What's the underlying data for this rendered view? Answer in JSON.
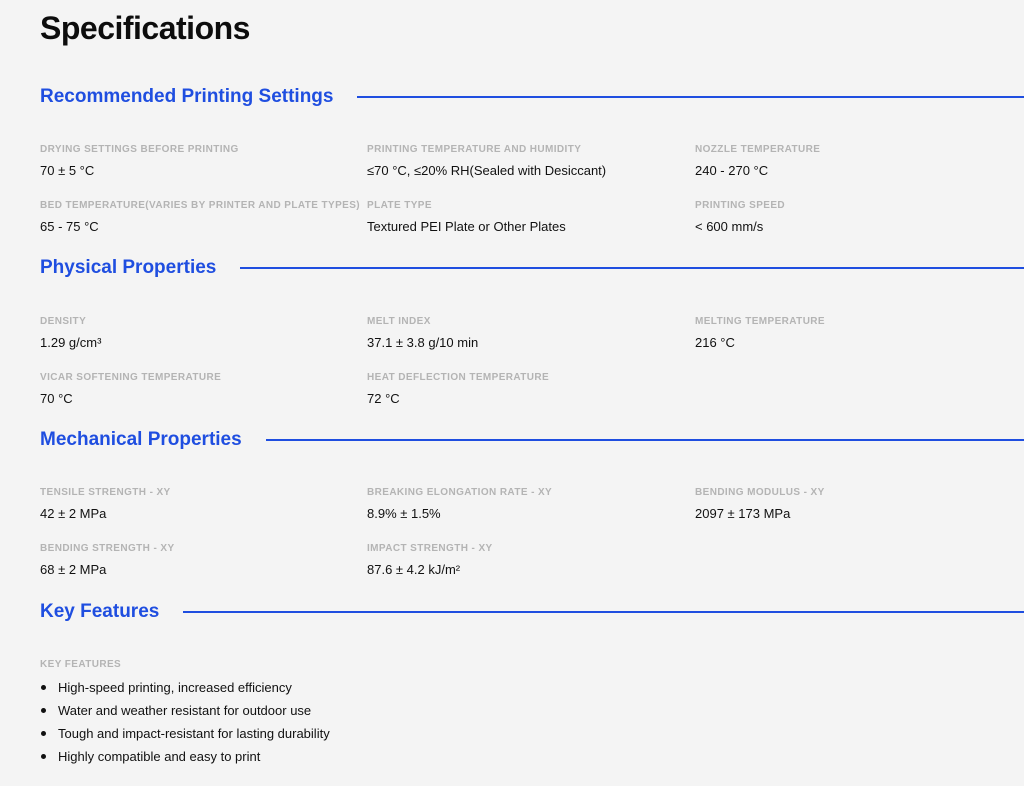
{
  "page": {
    "title": "Specifications"
  },
  "sections": [
    {
      "title": "Recommended Printing Settings",
      "items": [
        {
          "label": "DRYING SETTINGS BEFORE PRINTING",
          "value": "70 ± 5 °C"
        },
        {
          "label": "PRINTING TEMPERATURE AND HUMIDITY",
          "value": "≤70 °C, ≤20% RH(Sealed with Desiccant)"
        },
        {
          "label": "NOZZLE TEMPERATURE",
          "value": "240 - 270 °C"
        },
        {
          "label": "BED TEMPERATURE(VARIES BY PRINTER AND PLATE TYPES)",
          "value": "65 - 75 °C"
        },
        {
          "label": "PLATE TYPE",
          "value": "Textured PEI Plate or Other Plates"
        },
        {
          "label": "PRINTING SPEED",
          "value": "< 600 mm/s"
        }
      ]
    },
    {
      "title": "Physical Properties",
      "items": [
        {
          "label": "DENSITY",
          "value": "1.29 g/cm³"
        },
        {
          "label": "MELT INDEX",
          "value": "37.1 ± 3.8 g/10 min"
        },
        {
          "label": "MELTING TEMPERATURE",
          "value": "216 °C"
        },
        {
          "label": "VICAR SOFTENING TEMPERATURE",
          "value": "70 °C"
        },
        {
          "label": "HEAT DEFLECTION TEMPERATURE",
          "value": "72 °C"
        }
      ]
    },
    {
      "title": "Mechanical Properties",
      "items": [
        {
          "label": "TENSILE STRENGTH - XY",
          "value": "42 ± 2 MPa"
        },
        {
          "label": "BREAKING ELONGATION RATE - XY",
          "value": "8.9% ± 1.5%"
        },
        {
          "label": "BENDING MODULUS - XY",
          "value": "2097 ± 173 MPa"
        },
        {
          "label": "BENDING STRENGTH - XY",
          "value": "68 ± 2 MPa"
        },
        {
          "label": "IMPACT STRENGTH - XY",
          "value": "87.6 ± 4.2 kJ/m²"
        }
      ]
    },
    {
      "title": "Key Features",
      "label": "KEY FEATURES",
      "features": [
        "High-speed printing, increased efficiency",
        "Water and weather resistant for outdoor use",
        "Tough and impact-resistant for lasting durability",
        "Highly compatible and easy to print"
      ]
    }
  ],
  "colors": {
    "accent": "#1f4ee0",
    "label": "#b4b4b4",
    "background": "#f4f4f4"
  }
}
